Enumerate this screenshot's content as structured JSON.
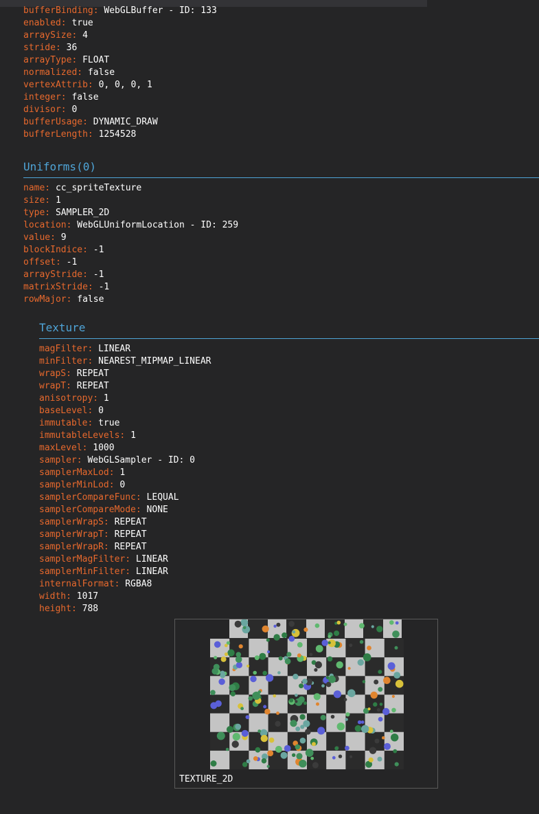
{
  "attribute": {
    "fields": [
      {
        "key": "bufferBinding:",
        "value": "WebGLBuffer - ID: 133"
      },
      {
        "key": "enabled:",
        "value": "true"
      },
      {
        "key": "arraySize:",
        "value": "4"
      },
      {
        "key": "stride:",
        "value": "36"
      },
      {
        "key": "arrayType:",
        "value": "FLOAT"
      },
      {
        "key": "normalized:",
        "value": "false"
      },
      {
        "key": "vertexAttrib:",
        "value": "0, 0, 0, 1"
      },
      {
        "key": "integer:",
        "value": "false"
      },
      {
        "key": "divisor:",
        "value": "0"
      },
      {
        "key": "bufferUsage:",
        "value": "DYNAMIC_DRAW"
      },
      {
        "key": "bufferLength:",
        "value": "1254528"
      }
    ]
  },
  "uniforms": {
    "title": "Uniforms(0)",
    "fields": [
      {
        "key": "name:",
        "value": "cc_spriteTexture"
      },
      {
        "key": "size:",
        "value": "1"
      },
      {
        "key": "type:",
        "value": "SAMPLER_2D"
      },
      {
        "key": "location:",
        "value": "WebGLUniformLocation - ID: 259"
      },
      {
        "key": "value:",
        "value": "9"
      },
      {
        "key": "blockIndice:",
        "value": "-1"
      },
      {
        "key": "offset:",
        "value": "-1"
      },
      {
        "key": "arrayStride:",
        "value": "-1"
      },
      {
        "key": "matrixStride:",
        "value": "-1"
      },
      {
        "key": "rowMajor:",
        "value": "false"
      }
    ]
  },
  "texture": {
    "title": "Texture",
    "fields": [
      {
        "key": "magFilter:",
        "value": "LINEAR"
      },
      {
        "key": "minFilter:",
        "value": "NEAREST_MIPMAP_LINEAR"
      },
      {
        "key": "wrapS:",
        "value": "REPEAT"
      },
      {
        "key": "wrapT:",
        "value": "REPEAT"
      },
      {
        "key": "anisotropy:",
        "value": "1"
      },
      {
        "key": "baseLevel:",
        "value": "0"
      },
      {
        "key": "immutable:",
        "value": "true"
      },
      {
        "key": "immutableLevels:",
        "value": "1"
      },
      {
        "key": "maxLevel:",
        "value": "1000"
      },
      {
        "key": "sampler:",
        "value": "WebGLSampler - ID: 0"
      },
      {
        "key": "samplerMaxLod:",
        "value": "1"
      },
      {
        "key": "samplerMinLod:",
        "value": "0"
      },
      {
        "key": "samplerCompareFunc:",
        "value": "LEQUAL"
      },
      {
        "key": "samplerCompareMode:",
        "value": "NONE"
      },
      {
        "key": "samplerWrapS:",
        "value": "REPEAT"
      },
      {
        "key": "samplerWrapT:",
        "value": "REPEAT"
      },
      {
        "key": "samplerWrapR:",
        "value": "REPEAT"
      },
      {
        "key": "samplerMagFilter:",
        "value": "LINEAR"
      },
      {
        "key": "samplerMinFilter:",
        "value": "LINEAR"
      },
      {
        "key": "internalFormat:",
        "value": "RGBA8"
      },
      {
        "key": "width:",
        "value": "1017"
      },
      {
        "key": "height:",
        "value": "788"
      }
    ],
    "preview_caption": "TEXTURE_2D"
  },
  "colors": {
    "background": "#252526",
    "key": "#e8692d",
    "value": "#ffffff",
    "section_title": "#4fa5d8",
    "checker_light": "#c4c4c4",
    "checker_dark": "#2b2b2b"
  }
}
